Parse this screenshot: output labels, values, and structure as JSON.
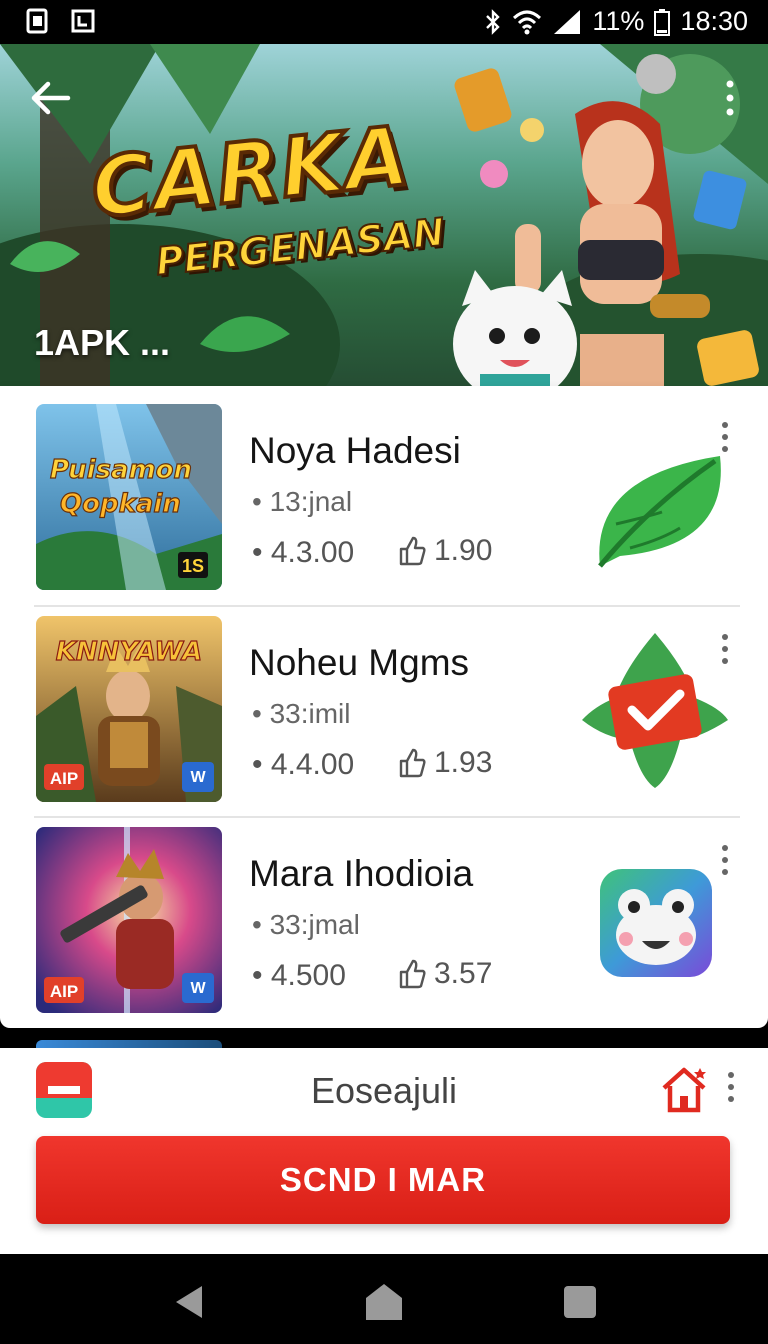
{
  "status_bar": {
    "battery": "11%",
    "time": "18:30",
    "left_icons": [
      "sim-icon",
      "notification-icon"
    ],
    "right_icons": [
      "bluetooth-icon",
      "wifi-icon",
      "signal-icon",
      "battery-icon"
    ]
  },
  "hero": {
    "title": "CARKA",
    "subtitle": "PERGENASAN",
    "caption": "1APK ...",
    "icons": [
      "back-arrow-icon",
      "more-vertical-icon"
    ]
  },
  "apps": [
    {
      "name": "Noya Hadesi",
      "meta": "• 13:jnal",
      "rating": "• 4.3.00",
      "downloads": "1.90",
      "thumb_title_line1": "Puisamon",
      "thumb_title_line2": "Qopkain",
      "thumb_badge": "1S",
      "icon": "green-leaf-icon"
    },
    {
      "name": "Noheu Mgms",
      "meta": "• 33:imil",
      "rating": "• 4.4.00",
      "downloads": "1.93",
      "thumb_title_line1": "KNNYAWA",
      "thumb_badge_left": "AIP",
      "thumb_badge_right": "W",
      "icon": "leaf-check-icon"
    },
    {
      "name": "Mara Ihodioia",
      "meta": "• 33:jmal",
      "rating": "• 4.500",
      "downloads": "3.57",
      "thumb_badge_left": "AIP",
      "thumb_badge_right": "W",
      "icon": "frog-face-icon"
    }
  ],
  "bottom_panel": {
    "title": "Eoseajuli",
    "button_label": "SCND I MAR",
    "icons": [
      "app-badge-icon",
      "home-icon",
      "more-vertical-icon"
    ]
  },
  "nav": {
    "icons": [
      "nav-back-icon",
      "nav-home-icon",
      "nav-recents-icon"
    ]
  },
  "colors": {
    "accent_red": "#e02a20",
    "text_dark": "#151515",
    "text_gray": "#666666"
  }
}
